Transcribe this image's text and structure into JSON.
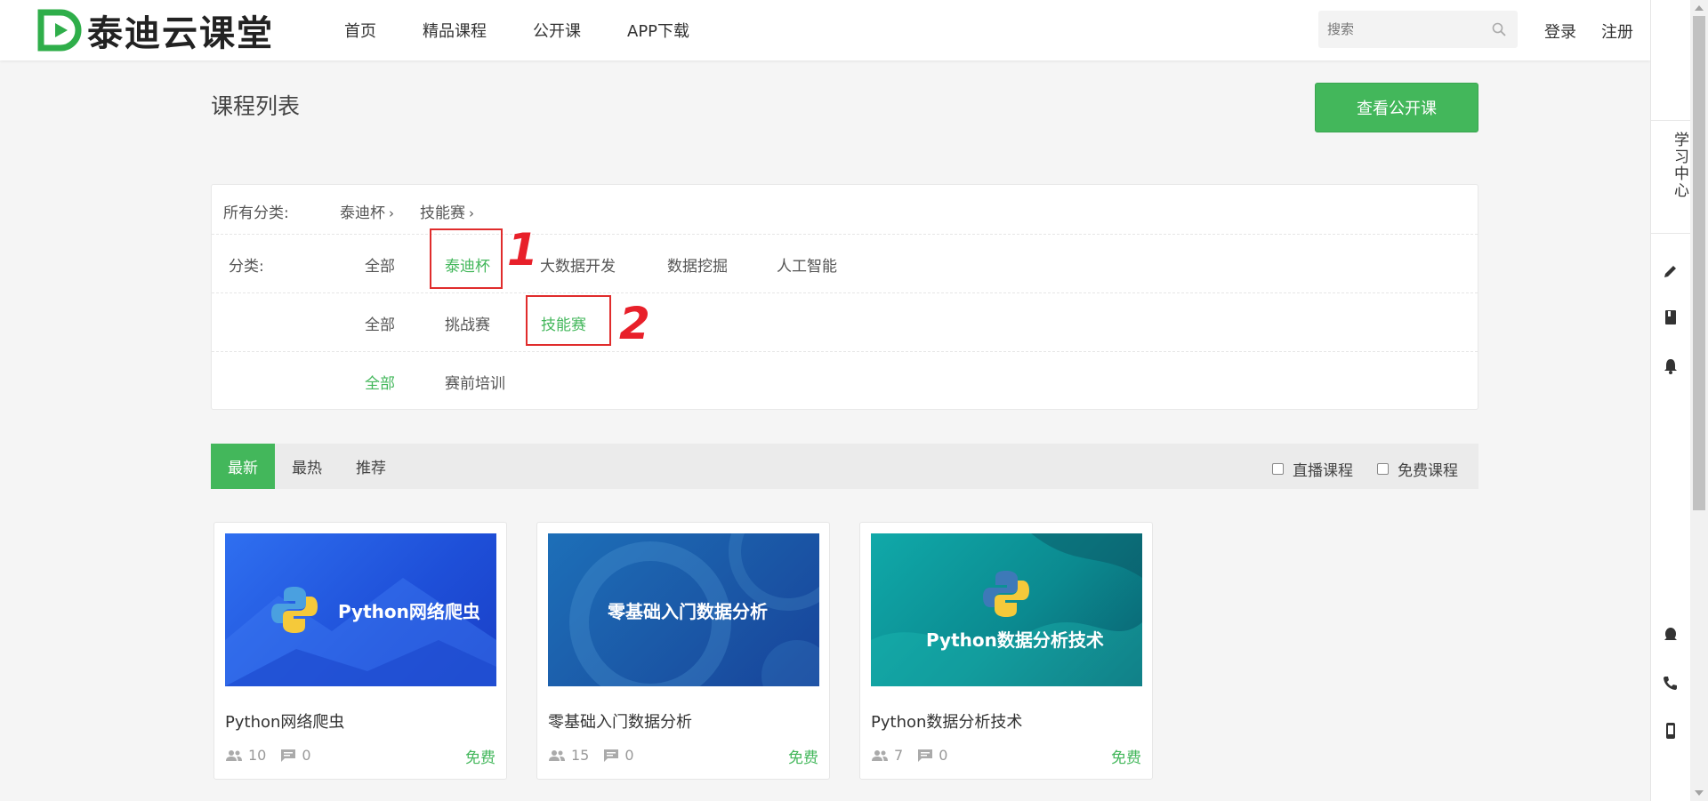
{
  "header": {
    "logo_text": "泰迪云课堂",
    "nav": [
      "首页",
      "精品课程",
      "公开课",
      "APP下载"
    ],
    "search_placeholder": "搜索",
    "login": "登录",
    "register": "注册"
  },
  "sidebar": {
    "study_center": "学习中心",
    "icons": [
      "pencil-icon",
      "book-icon",
      "bell-icon",
      "qq-icon",
      "phone-icon",
      "mobile-icon"
    ]
  },
  "page": {
    "title": "课程列表",
    "open_course_button": "查看公开课"
  },
  "filter": {
    "all_label": "所有分类:",
    "breadcrumb": [
      "泰迪杯",
      "技能赛"
    ],
    "category_label": "分类:",
    "row1": [
      "全部",
      "泰迪杯",
      "大数据开发",
      "数据挖掘",
      "人工智能"
    ],
    "row1_active": "泰迪杯",
    "row2": [
      "全部",
      "挑战赛",
      "技能赛"
    ],
    "row2_active": "技能赛",
    "row3": [
      "全部",
      "赛前培训"
    ],
    "row3_active": "全部",
    "annotations": [
      "1",
      "2"
    ]
  },
  "sortbar": {
    "tabs": [
      "最新",
      "最热",
      "推荐"
    ],
    "active": "最新",
    "checkbox_live": "直播课程",
    "checkbox_free": "免费课程"
  },
  "courses": [
    {
      "thumb_text": "Python网络爬虫",
      "title": "Python网络爬虫",
      "students": "10",
      "comments": "0",
      "price": "免费"
    },
    {
      "thumb_text": "零基础入门数据分析",
      "title": "零基础入门数据分析",
      "students": "15",
      "comments": "0",
      "price": "免费"
    },
    {
      "thumb_text": "Python数据分析技术",
      "title": "Python数据分析技术",
      "students": "7",
      "comments": "0",
      "price": "免费"
    }
  ],
  "colors": {
    "accent": "#43b75b",
    "annotation": "#e02c2c"
  }
}
